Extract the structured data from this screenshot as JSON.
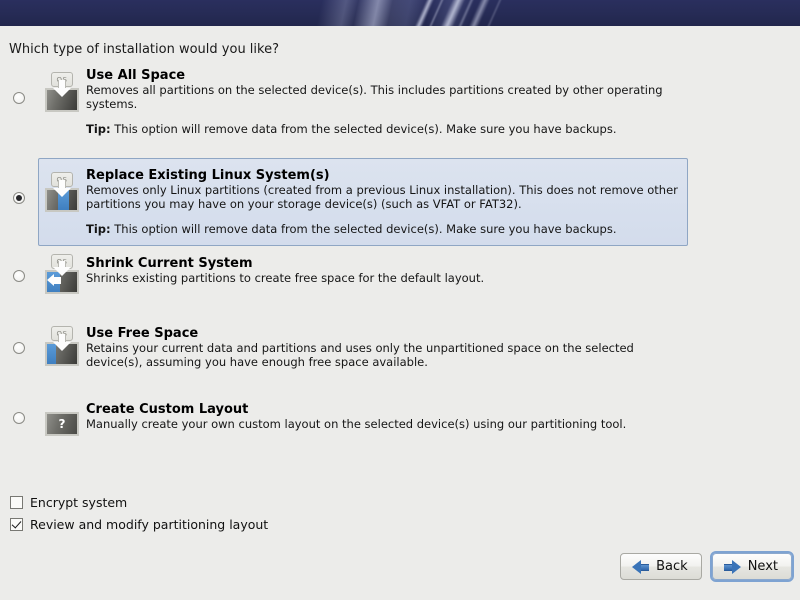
{
  "header": {
    "banner_color": "#262b55",
    "accent_streak_color": "#dee2f5"
  },
  "page_question": "Which type of installation would you like?",
  "theme": {
    "background": "#ececea",
    "selection_background": "#d6dfee",
    "selection_border": "#8fa6c4",
    "accent_blue": "#3f7fc0"
  },
  "options": [
    {
      "id": "use-all-space",
      "title": "Use All Space",
      "description": "Removes all partitions on the selected device(s).  This includes partitions created by other operating systems.",
      "tip_label": "Tip:",
      "tip_text": "This option will remove data from the selected device(s).  Make sure you have backups.",
      "icon": "disk-arrow-down-icon",
      "icon_os_label": "OS",
      "selected": false
    },
    {
      "id": "replace-existing-linux",
      "title": "Replace Existing Linux System(s)",
      "description": "Removes only Linux partitions (created from a previous Linux installation).  This does not remove other partitions you may have on your storage device(s) (such as VFAT or FAT32).",
      "tip_label": "Tip:",
      "tip_text": "This option will remove data from the selected device(s).  Make sure you have backups.",
      "icon": "disk-arrow-down-blue-center-icon",
      "icon_os_label": "OS",
      "selected": true
    },
    {
      "id": "shrink-current-system",
      "title": "Shrink Current System",
      "description": "Shrinks existing partitions to create free space for the default layout.",
      "tip_label": "",
      "tip_text": "",
      "icon": "disk-arrow-left-icon",
      "icon_os_label": "OS",
      "selected": false
    },
    {
      "id": "use-free-space",
      "title": "Use Free Space",
      "description": "Retains your current data and partitions and uses only the unpartitioned space on the selected device(s), assuming you have enough free space available.",
      "tip_label": "",
      "tip_text": "",
      "icon": "disk-blue-left-icon",
      "icon_os_label": "OS",
      "selected": false
    },
    {
      "id": "create-custom-layout",
      "title": "Create Custom Layout",
      "description": "Manually create your own custom layout on the selected device(s) using our partitioning tool.",
      "tip_label": "",
      "tip_text": "",
      "icon": "question-mark-disk-icon",
      "icon_os_label": "?",
      "selected": false
    }
  ],
  "checkboxes": [
    {
      "id": "encrypt-system",
      "label": "Encrypt system",
      "checked": false
    },
    {
      "id": "review-modify-partitioning",
      "label": "Review and modify partitioning layout",
      "checked": true
    }
  ],
  "footer": {
    "back_label": "Back",
    "next_label": "Next",
    "back_icon": "arrow-left-icon",
    "next_icon": "arrow-right-icon",
    "focused_button": "next"
  }
}
